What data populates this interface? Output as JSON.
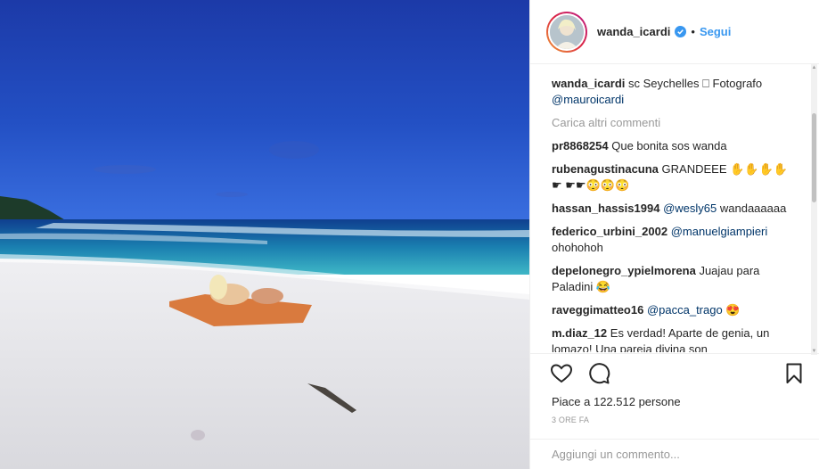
{
  "post": {
    "username": "wanda_icardi",
    "follow_label": "Segui",
    "separator": "•",
    "caption": {
      "username": "wanda_icardi",
      "text": "sc Seychelles ⎕ Fotografo",
      "mention": "@mauroicardi"
    },
    "load_more": "Carica altri commenti",
    "comments": [
      {
        "user": "pr8868254",
        "text": "Que bonita sos wanda",
        "mention": ""
      },
      {
        "user": "rubenagustinacuna",
        "text": "GRANDEEE ✋✋✋✋☛ ☛☛😳😳😳",
        "mention": ""
      },
      {
        "user": "hassan_hassis1994",
        "mention": "@wesly65",
        "text": "wandaaaaaa"
      },
      {
        "user": "federico_urbini_2002",
        "mention": "@manuelgiampieri",
        "text": "ohohohoh"
      },
      {
        "user": "depelonegro_ypielmorena",
        "text": "Juajau para Paladini 😂",
        "mention": ""
      },
      {
        "user": "raveggimatteo16",
        "mention": "@pacca_trago",
        "text": "😍"
      },
      {
        "user": "m.diaz_12",
        "text": "Es verdad! Aparte de genia, un lomazo! Una pareja divina son",
        "mention": ""
      }
    ],
    "likes_text": "Piace a 122.512 persone",
    "time_text": "3 ORE FA",
    "add_comment_placeholder": "Aggiungi un commento...",
    "icons": {
      "like": "heart-icon",
      "comment": "comment-icon",
      "save": "bookmark-icon",
      "verified": "verified-badge-icon"
    },
    "colors": {
      "link": "#3897f0",
      "mention": "#003569",
      "muted": "#999999",
      "verified": "#3897f0"
    }
  }
}
